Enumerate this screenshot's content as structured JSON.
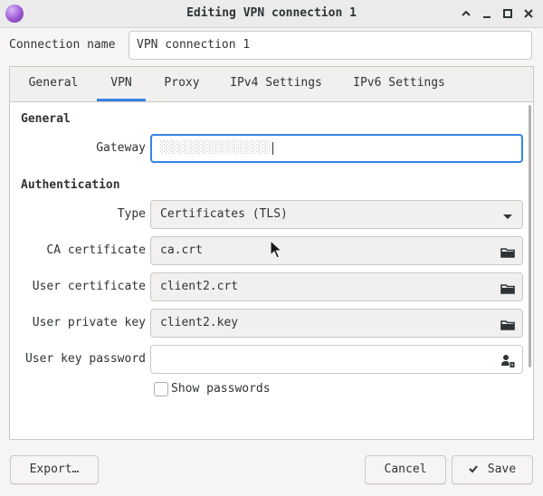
{
  "window": {
    "title": "Editing VPN connection 1",
    "controls": [
      "chevron-up-icon",
      "minimize-icon",
      "maximize-icon",
      "close-icon"
    ]
  },
  "connection": {
    "label": "Connection name",
    "value": "VPN connection 1"
  },
  "tabs": [
    {
      "label": "General"
    },
    {
      "label": "VPN",
      "active": true
    },
    {
      "label": "Proxy"
    },
    {
      "label": "IPv4 Settings"
    },
    {
      "label": "IPv6 Settings"
    }
  ],
  "vpn": {
    "general_title": "General",
    "gateway_label": "Gateway",
    "gateway_value": "░░░░░░░░░░░░░░░░░░",
    "auth_title": "Authentication",
    "type_label": "Type",
    "type_value": "Certificates (TLS)",
    "ca_label": "CA certificate",
    "ca_value": "ca.crt",
    "user_cert_label": "User certificate",
    "user_cert_value": "client2.crt",
    "user_key_label": "User private key",
    "user_key_value": "client2.key",
    "user_key_password_label": "User key password",
    "user_key_password_value": "",
    "show_passwords_label": "Show passwords",
    "show_passwords_checked": false
  },
  "buttons": {
    "export": "Export…",
    "cancel": "Cancel",
    "save": "Save"
  },
  "colors": {
    "accent": "#3584e4",
    "app_icon": "#9b59d0"
  }
}
